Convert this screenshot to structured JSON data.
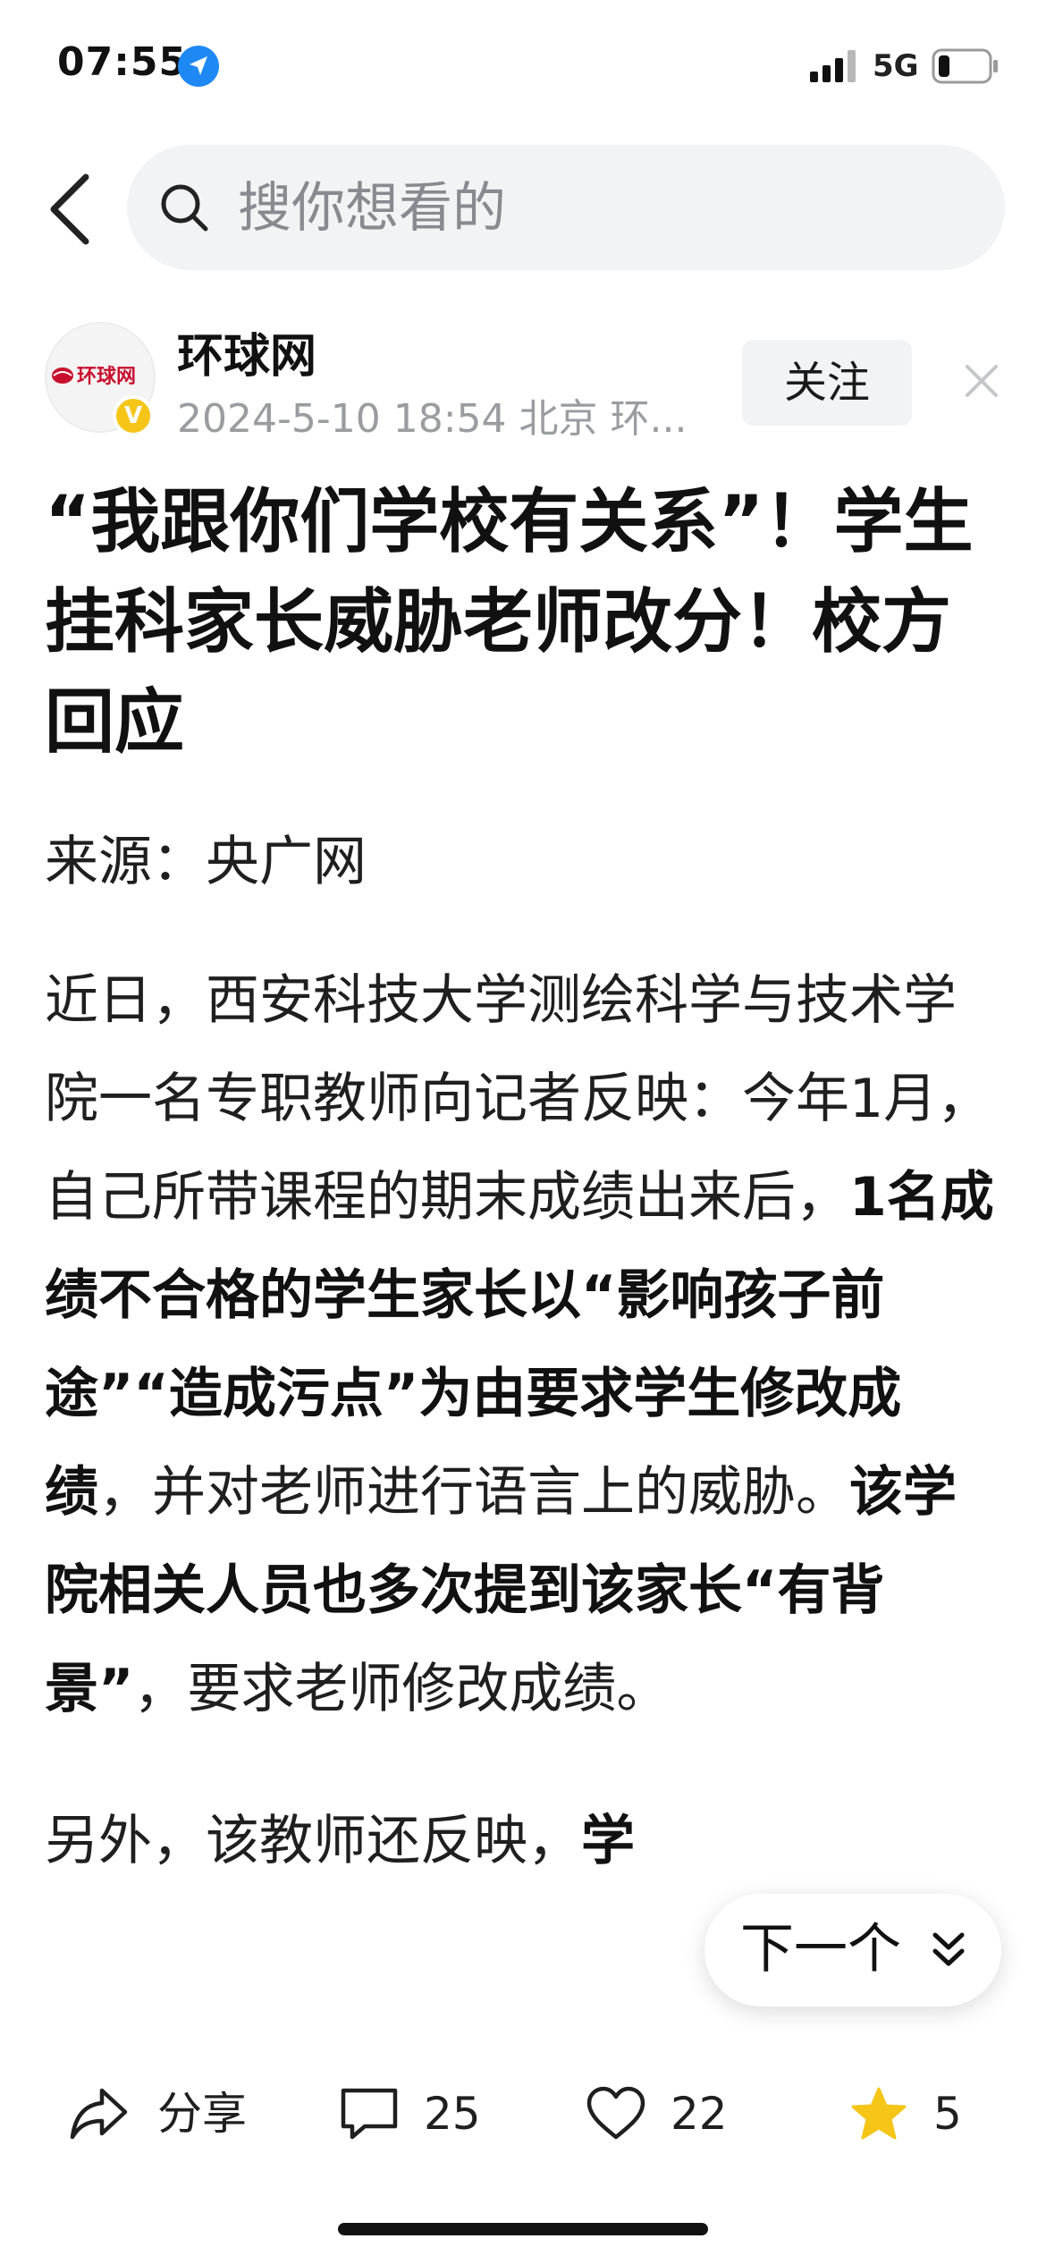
{
  "status_bar": {
    "time": "07:55",
    "network": "5G"
  },
  "header": {
    "search_placeholder": "搜你想看的"
  },
  "author": {
    "name": "环球网",
    "avatar_text": "环球网",
    "verified_mark": "V",
    "meta": "2024-5-10 18:54 北京 环...",
    "follow_label": "关注"
  },
  "article": {
    "title": "“我跟你们学校有关系”！学生挂科家长威胁老师改分！校方回应",
    "source": "来源：央广网",
    "paragraph1": {
      "s1": "近日，西安科技大学测绘科学与技术学院一名专职教师向记者反映：今年1月，自己所带课程的期末成绩出来后，",
      "b1": "1名成绩不合格的学生家长以“影响孩子前途”“造成污点”为由要求学生修改成绩",
      "s2": "，并对老师进行语言上的威胁。",
      "b2": "该学院相关人员也多次提到该家长“有背景”",
      "s3": "，要求老师修改成绩。"
    },
    "paragraph2": {
      "s1": "另外，该教师还反映，",
      "b1": "学"
    }
  },
  "next_button": {
    "label": "下一个"
  },
  "actions": {
    "share_label": "分享",
    "comments_count": "25",
    "likes_count": "22",
    "favorites_count": "5"
  },
  "colors": {
    "favorite_star": "#f5c518",
    "verified_badge": "#f5c518",
    "avatar_brand_red": "#c8102e",
    "location_blue": "#1e88f5",
    "muted_text": "#9a9ca0",
    "search_bg": "#f2f3f5"
  },
  "icons": {
    "location": "location-arrow-icon",
    "signal": "signal-bars-icon",
    "battery": "battery-icon",
    "back": "chevron-left-icon",
    "search": "search-icon",
    "close": "close-icon",
    "next": "chevron-double-down-icon",
    "share": "share-arrow-icon",
    "comment": "comment-bubble-icon",
    "like": "heart-icon",
    "favorite": "star-icon"
  }
}
